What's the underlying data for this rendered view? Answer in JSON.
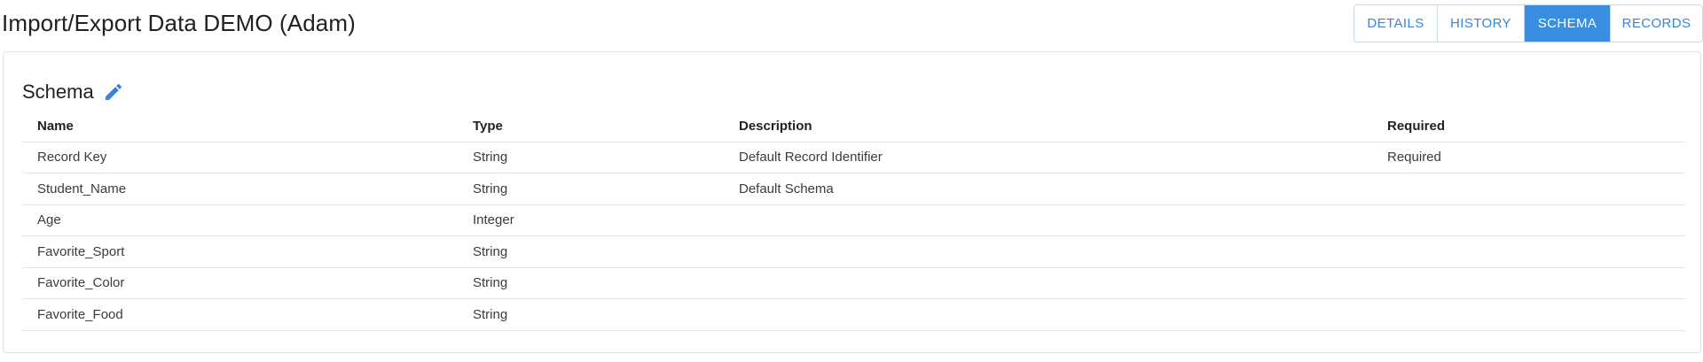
{
  "header": {
    "title": "Import/Export Data DEMO (Adam)"
  },
  "tabs": [
    {
      "label": "DETAILS",
      "active": false
    },
    {
      "label": "HISTORY",
      "active": false
    },
    {
      "label": "SCHEMA",
      "active": true
    },
    {
      "label": "RECORDS",
      "active": false
    }
  ],
  "schema": {
    "title": "Schema",
    "edit_icon": "pencil-icon",
    "columns": [
      "Name",
      "Type",
      "Description",
      "Required"
    ],
    "rows": [
      {
        "name": "Record Key",
        "type": "String",
        "description": "Default Record Identifier",
        "required": "Required"
      },
      {
        "name": "Student_Name",
        "type": "String",
        "description": "Default Schema",
        "required": ""
      },
      {
        "name": "Age",
        "type": "Integer",
        "description": "",
        "required": ""
      },
      {
        "name": "Favorite_Sport",
        "type": "String",
        "description": "",
        "required": ""
      },
      {
        "name": "Favorite_Color",
        "type": "String",
        "description": "",
        "required": ""
      },
      {
        "name": "Favorite_Food",
        "type": "String",
        "description": "",
        "required": ""
      }
    ]
  },
  "colors": {
    "accent": "#3a8ee0",
    "tab_text": "#3a84d6",
    "border": "#e2e2e2"
  }
}
